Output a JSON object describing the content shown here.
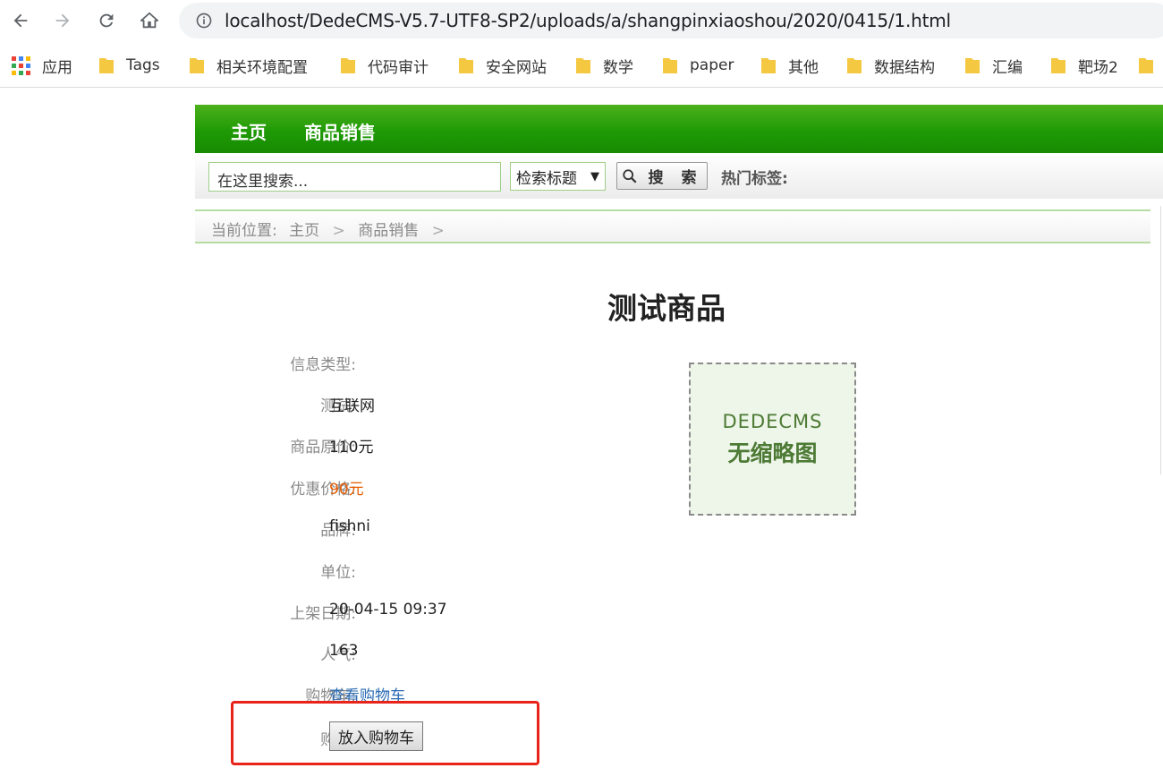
{
  "browser": {
    "url": "localhost/DedeCMS-V5.7-UTF8-SP2/uploads/a/shangpinxiaoshou/2020/0415/1.html",
    "bookmarks": [
      {
        "label": "应用",
        "icon": "apps-icon"
      },
      {
        "label": "Tags",
        "icon": "folder-icon"
      },
      {
        "label": "相关环境配置",
        "icon": "folder-icon"
      },
      {
        "label": "代码审计",
        "icon": "folder-icon"
      },
      {
        "label": "安全网站",
        "icon": "folder-icon"
      },
      {
        "label": "数学",
        "icon": "folder-icon"
      },
      {
        "label": "paper",
        "icon": "folder-icon"
      },
      {
        "label": "其他",
        "icon": "folder-icon"
      },
      {
        "label": "数据结构",
        "icon": "folder-icon"
      },
      {
        "label": "汇编",
        "icon": "folder-icon"
      },
      {
        "label": "靶场2",
        "icon": "folder-icon"
      }
    ]
  },
  "site": {
    "nav": [
      "主页",
      "商品销售"
    ],
    "search": {
      "placeholder": "在这里搜索...",
      "select": "检索标题",
      "button": "搜 索",
      "hot_tags": "热门标签:"
    },
    "breadcrumb": {
      "prefix": "当前位置:",
      "items": [
        "主页",
        "商品销售"
      ],
      "sep": ">"
    }
  },
  "product": {
    "title": "测试商品",
    "fields": [
      {
        "label": "信息类型:",
        "value": ""
      },
      {
        "label": "测试:",
        "value": "互联网"
      },
      {
        "label": "商品原价:",
        "value": "110元"
      },
      {
        "label": "优惠价格:",
        "value": "90元"
      },
      {
        "label": "品牌:",
        "value": "fishni"
      },
      {
        "label": "单位:",
        "value": ""
      },
      {
        "label": "上架日期:",
        "value": "20-04-15 09:37"
      },
      {
        "label": "人气:",
        "value": "163"
      },
      {
        "label": "购物车:",
        "value": "查看购物车"
      },
      {
        "label": "购买:",
        "value": "放入购物车"
      }
    ],
    "thumbnail": {
      "line1": "DEDECMS",
      "line2": "无缩略图"
    }
  },
  "colors": {
    "nav_green": "#1f9a06",
    "price": "#e65c00",
    "link": "#2a6bb3",
    "highlight": "#e8231a"
  }
}
